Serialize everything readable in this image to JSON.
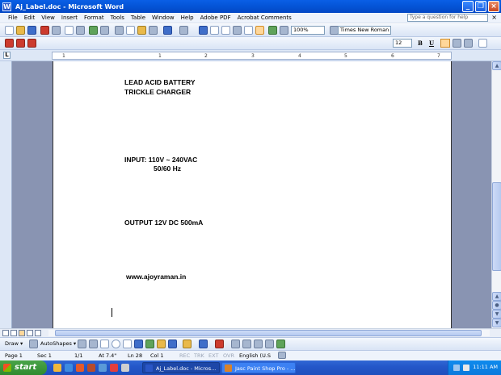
{
  "window": {
    "title": "Aj_Label.doc - Microsoft Word",
    "app_icon": "W",
    "minimize": "_",
    "maximize": "❐",
    "close": "×"
  },
  "menu": {
    "items": [
      "File",
      "Edit",
      "View",
      "Insert",
      "Format",
      "Tools",
      "Table",
      "Window",
      "Help",
      "Adobe PDF",
      "Acrobat Comments"
    ],
    "ask_placeholder": "Type a question for help",
    "doc_close": "×"
  },
  "toolbar": {
    "zoom": "100%",
    "font_name": "Times New Roman",
    "font_size": "12",
    "bold": "B",
    "underline": "U"
  },
  "ruler": {
    "ticks": [
      "1",
      "1",
      "2",
      "3",
      "4",
      "5",
      "6",
      "7"
    ]
  },
  "document": {
    "line1": "LEAD ACID BATTERY",
    "line2": "TRICKLE   CHARGER",
    "input_line1": "INPUT:  110V ~ 240VAC",
    "input_line2": "50/60 Hz",
    "output": "OUTPUT 12V DC 500mA",
    "website": "www.ajoyraman.in"
  },
  "drawing_toolbar": {
    "draw": "Draw ▾",
    "autoshapes": "AutoShapes ▾"
  },
  "status": {
    "page": "Page 1",
    "section": "Sec 1",
    "pages": "1/1",
    "at": "At  7.4\"",
    "line": "Ln  28",
    "col": "Col  1",
    "rec": "REC",
    "trk": "TRK",
    "ext": "EXT",
    "ovr": "OVR",
    "language": "English (U.S"
  },
  "taskbar": {
    "start": "start",
    "tasks": [
      "Aj_Label.doc - Micros...",
      "Jasc Paint Shop Pro - ..."
    ],
    "clock": "11:11 AM"
  }
}
